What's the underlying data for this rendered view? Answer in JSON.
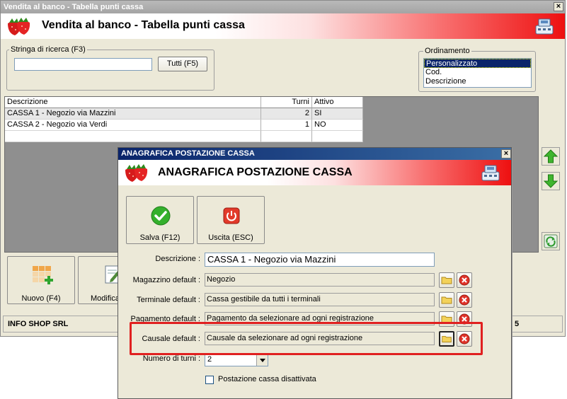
{
  "main_window": {
    "title": "Vendita al banco - Tabella punti cassa",
    "banner_title": "Vendita al banco - Tabella punti cassa",
    "close_glyph": "×"
  },
  "search": {
    "legend": "Stringa di ricerca (F3)",
    "value": "",
    "placeholder": "",
    "all_button": "Tutti (F5)"
  },
  "ordering": {
    "legend": "Ordinamento",
    "options": [
      "Personalizzato",
      "Cod.",
      "Descrizione"
    ],
    "selected": "Personalizzato"
  },
  "grid": {
    "columns": [
      "Descrizione",
      "Turni",
      "Attivo"
    ],
    "rows": [
      {
        "descrizione": "CASSA 1 - Negozio via Mazzini",
        "turni": "2",
        "attivo": "SI"
      },
      {
        "descrizione": "CASSA 2 - Negozio via Verdi",
        "turni": "1",
        "attivo": "NO"
      }
    ]
  },
  "main_buttons": {
    "new": "Nuovo (F4)",
    "edit": "Modifica"
  },
  "status_bar": {
    "company": "INFO SHOP SRL",
    "right_fragment": "5"
  },
  "dialog": {
    "title": "ANAGRAFICA POSTAZIONE CASSA",
    "banner_title": "ANAGRAFICA POSTAZIONE CASSA",
    "close_glyph": "×",
    "save_button": "Salva (F12)",
    "exit_button": "Uscita (ESC)",
    "fields": {
      "descrizione": {
        "label": "Descrizione :",
        "value": "CASSA 1 - Negozio via Mazzini"
      },
      "magazzino": {
        "label": "Magazzino default :",
        "value": "Negozio"
      },
      "terminale": {
        "label": "Terminale default :",
        "value": "Cassa gestibile da tutti i terminali"
      },
      "pagamento": {
        "label": "Pagamento default :",
        "value": "Pagamento da selezionare ad ogni registrazione"
      },
      "causale": {
        "label": "Causale default :",
        "value": "Causale da selezionare ad ogni registrazione"
      },
      "turni": {
        "label": "Numero di turni :",
        "value": "2"
      }
    },
    "disabled_checkbox": {
      "label": "Postazione cassa disattivata",
      "checked": false
    }
  },
  "colors": {
    "highlight": "#e02020",
    "selection": "#0a246a",
    "dialog_titlebar": "#0a246a",
    "banner_red": "#ee1010"
  },
  "icons": {
    "banner_left": "strawberries-icon",
    "banner_right": "cash-register-icon",
    "save": "green-check-icon",
    "exit": "red-power-icon",
    "folder": "folder-icon",
    "clear": "red-x-icon",
    "up": "green-arrow-up-icon",
    "down": "green-arrow-down-icon",
    "refresh": "refresh-icon",
    "new": "grid-plus-icon",
    "edit": "edit-icon"
  }
}
